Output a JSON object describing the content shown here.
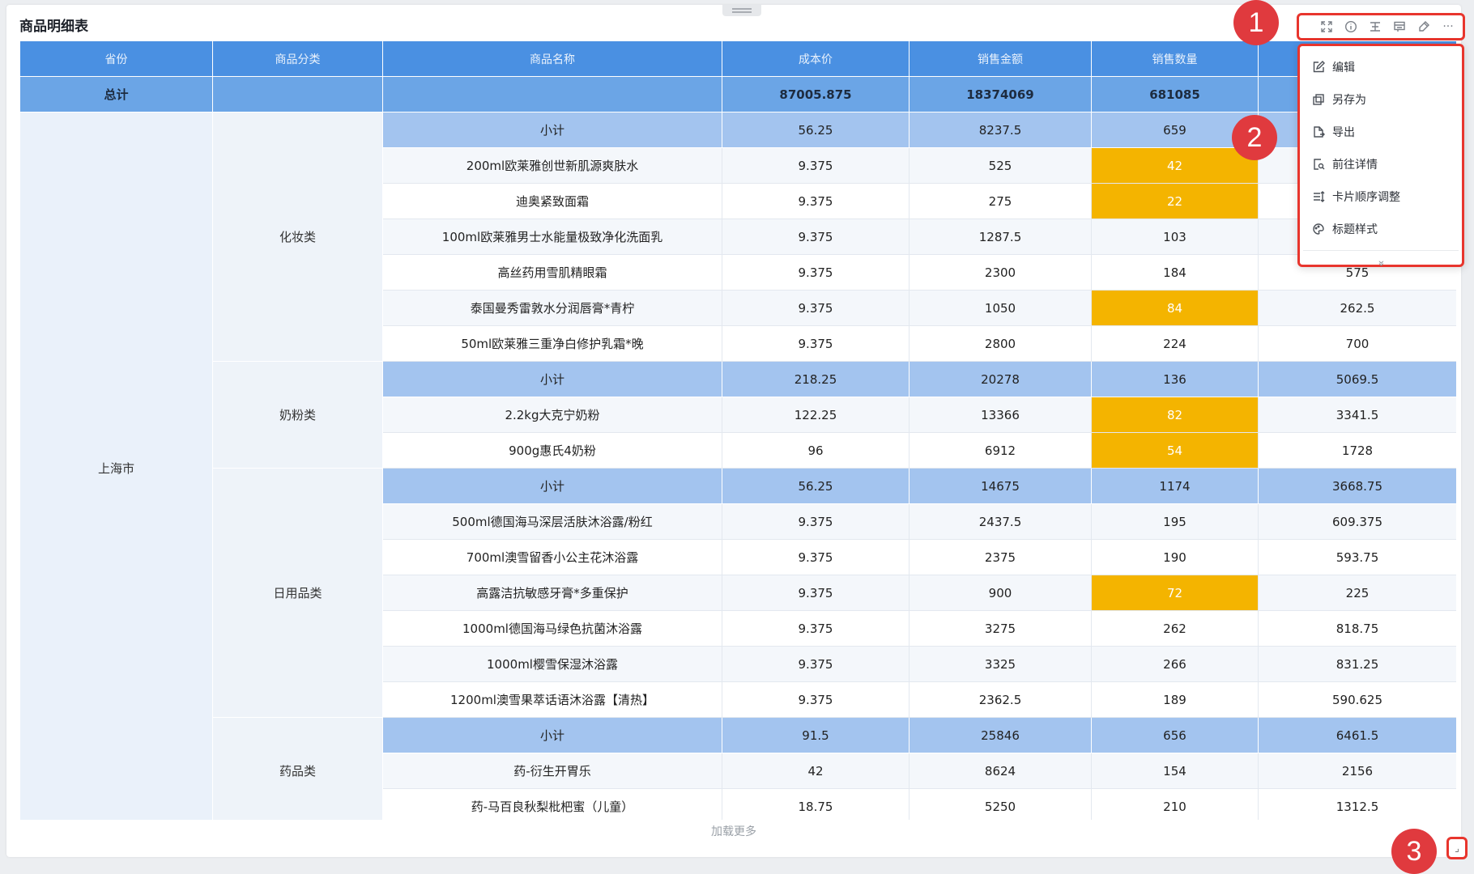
{
  "title": "商品明细表",
  "toolbar": {
    "icons": [
      "fullscreen-icon",
      "info-icon",
      "filter-icon",
      "linkage-icon",
      "edit-brush-icon",
      "more-icon"
    ],
    "more_label": "···"
  },
  "columns": [
    "省份",
    "商品分类",
    "商品名称",
    "成本价",
    "销售金额",
    "销售数量",
    ""
  ],
  "total": {
    "label": "总计",
    "cost": "87005.875",
    "amount": "18374069",
    "qty": "681085",
    "extra": ""
  },
  "province": "上海市",
  "groups": [
    {
      "category": "化妆类",
      "subtotal": {
        "label": "小计",
        "cost": "56.25",
        "amount": "8237.5",
        "qty": "659",
        "extra": ""
      },
      "items": [
        {
          "name": "200ml欧莱雅创世新肌源爽肤水",
          "cost": "9.375",
          "amount": "525",
          "qty": "42",
          "extra": "",
          "highlight": true
        },
        {
          "name": "迪奥紧致面霜",
          "cost": "9.375",
          "amount": "275",
          "qty": "22",
          "extra": "",
          "highlight": true
        },
        {
          "name": "100ml欧莱雅男士水能量极致净化洗面乳",
          "cost": "9.375",
          "amount": "1287.5",
          "qty": "103",
          "extra": "",
          "highlight": false
        },
        {
          "name": "高丝药用雪肌精眼霜",
          "cost": "9.375",
          "amount": "2300",
          "qty": "184",
          "extra": "575",
          "highlight": false
        },
        {
          "name": "泰国曼秀雷敦水分润唇膏*青柠",
          "cost": "9.375",
          "amount": "1050",
          "qty": "84",
          "extra": "262.5",
          "highlight": true
        },
        {
          "name": "50ml欧莱雅三重净白修护乳霜*晚",
          "cost": "9.375",
          "amount": "2800",
          "qty": "224",
          "extra": "700",
          "highlight": false
        }
      ]
    },
    {
      "category": "奶粉类",
      "subtotal": {
        "label": "小计",
        "cost": "218.25",
        "amount": "20278",
        "qty": "136",
        "extra": "5069.5"
      },
      "items": [
        {
          "name": "2.2kg大克宁奶粉",
          "cost": "122.25",
          "amount": "13366",
          "qty": "82",
          "extra": "3341.5",
          "highlight": true
        },
        {
          "name": "900g惠氏4奶粉",
          "cost": "96",
          "amount": "6912",
          "qty": "54",
          "extra": "1728",
          "highlight": true
        }
      ]
    },
    {
      "category": "日用品类",
      "subtotal": {
        "label": "小计",
        "cost": "56.25",
        "amount": "14675",
        "qty": "1174",
        "extra": "3668.75"
      },
      "items": [
        {
          "name": "500ml德国海马深层活肤沐浴露/粉红",
          "cost": "9.375",
          "amount": "2437.5",
          "qty": "195",
          "extra": "609.375",
          "highlight": false
        },
        {
          "name": "700ml澳雪留香小公主花沐浴露",
          "cost": "9.375",
          "amount": "2375",
          "qty": "190",
          "extra": "593.75",
          "highlight": false
        },
        {
          "name": "高露洁抗敏感牙膏*多重保护",
          "cost": "9.375",
          "amount": "900",
          "qty": "72",
          "extra": "225",
          "highlight": true
        },
        {
          "name": "1000ml德国海马绿色抗菌沐浴露",
          "cost": "9.375",
          "amount": "3275",
          "qty": "262",
          "extra": "818.75",
          "highlight": false
        },
        {
          "name": "1000ml樱雪保湿沐浴露",
          "cost": "9.375",
          "amount": "3325",
          "qty": "266",
          "extra": "831.25",
          "highlight": false
        },
        {
          "name": "1200ml澳雪果萃话语沐浴露【清热】",
          "cost": "9.375",
          "amount": "2362.5",
          "qty": "189",
          "extra": "590.625",
          "highlight": false
        }
      ]
    },
    {
      "category": "药品类",
      "subtotal": {
        "label": "小计",
        "cost": "91.5",
        "amount": "25846",
        "qty": "656",
        "extra": "6461.5"
      },
      "items": [
        {
          "name": "药-衍生开胃乐",
          "cost": "42",
          "amount": "8624",
          "qty": "154",
          "extra": "2156",
          "highlight": false
        },
        {
          "name": "药-马百良秋梨枇杷蜜（儿童）",
          "cost": "18.75",
          "amount": "5250",
          "qty": "210",
          "extra": "1312.5",
          "highlight": false
        }
      ]
    }
  ],
  "load_more": "加载更多",
  "menu": {
    "items": [
      {
        "label": "编辑",
        "icon": "edit-icon"
      },
      {
        "label": "另存为",
        "icon": "save-as-icon"
      },
      {
        "label": "导出",
        "icon": "export-icon"
      },
      {
        "label": "前往详情",
        "icon": "detail-icon"
      },
      {
        "label": "卡片顺序调整",
        "icon": "reorder-icon"
      },
      {
        "label": "标题样式",
        "icon": "palette-icon"
      }
    ],
    "more": "»"
  },
  "badges": [
    "1",
    "2",
    "3"
  ],
  "colors": {
    "header": "#4a90e2",
    "total": "#6ba5e6",
    "subtotal": "#a3c4ef",
    "highlight": "#f4b400",
    "annotation": "#e03a3e"
  }
}
